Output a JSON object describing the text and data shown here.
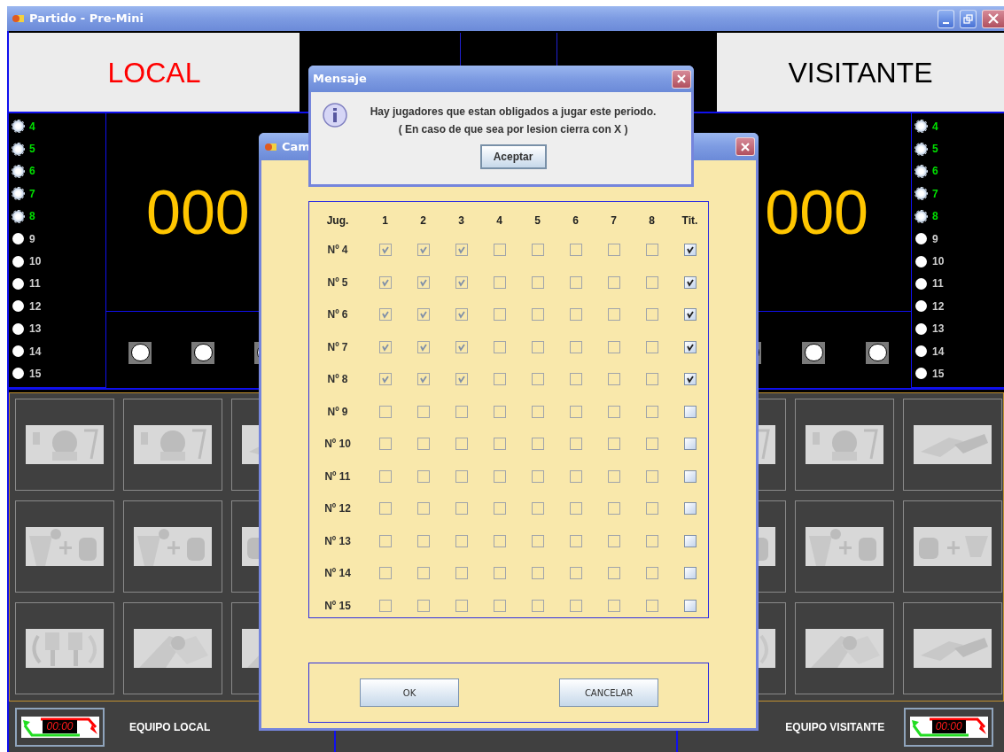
{
  "window": {
    "title": "Partido - Pre-Mini"
  },
  "home": {
    "name": "LOCAL",
    "score": "000",
    "players": [
      {
        "number": "4",
        "on_court": true
      },
      {
        "number": "5",
        "on_court": true
      },
      {
        "number": "6",
        "on_court": true
      },
      {
        "number": "7",
        "on_court": true
      },
      {
        "number": "8",
        "on_court": true
      },
      {
        "number": "9",
        "on_court": false
      },
      {
        "number": "10",
        "on_court": false
      },
      {
        "number": "11",
        "on_court": false
      },
      {
        "number": "12",
        "on_court": false
      },
      {
        "number": "13",
        "on_court": false
      },
      {
        "number": "14",
        "on_court": false
      },
      {
        "number": "15",
        "on_court": false
      }
    ],
    "team_label": "EQUIPO LOCAL",
    "clock": "00:00"
  },
  "away": {
    "name": "VISITANTE",
    "score": "000",
    "players": [
      {
        "number": "4",
        "on_court": true
      },
      {
        "number": "5",
        "on_court": true
      },
      {
        "number": "6",
        "on_court": true
      },
      {
        "number": "7",
        "on_court": true
      },
      {
        "number": "8",
        "on_court": true
      },
      {
        "number": "9",
        "on_court": false
      },
      {
        "number": "10",
        "on_court": false
      },
      {
        "number": "11",
        "on_court": false
      },
      {
        "number": "12",
        "on_court": false
      },
      {
        "number": "13",
        "on_court": false
      },
      {
        "number": "14",
        "on_court": false
      },
      {
        "number": "15",
        "on_court": false
      }
    ],
    "team_label": "EQUIPO VISITANTE",
    "clock": "00:00"
  },
  "change_dialog": {
    "title": "Cam",
    "columns": [
      "Jug.",
      "1",
      "2",
      "3",
      "4",
      "5",
      "6",
      "7",
      "8",
      "Tit."
    ],
    "period_boxes_disabled": true,
    "rows": [
      {
        "label": "Nº 4",
        "periods": [
          true,
          true,
          true,
          false,
          false,
          false,
          false,
          false
        ],
        "starter": true
      },
      {
        "label": "Nº 5",
        "periods": [
          true,
          true,
          true,
          false,
          false,
          false,
          false,
          false
        ],
        "starter": true
      },
      {
        "label": "Nº 6",
        "periods": [
          true,
          true,
          true,
          false,
          false,
          false,
          false,
          false
        ],
        "starter": true
      },
      {
        "label": "Nº 7",
        "periods": [
          true,
          true,
          true,
          false,
          false,
          false,
          false,
          false
        ],
        "starter": true
      },
      {
        "label": "Nº 8",
        "periods": [
          true,
          true,
          true,
          false,
          false,
          false,
          false,
          false
        ],
        "starter": true
      },
      {
        "label": "Nº 9",
        "periods": [
          false,
          false,
          false,
          false,
          false,
          false,
          false,
          false
        ],
        "starter": false
      },
      {
        "label": "Nº 10",
        "periods": [
          false,
          false,
          false,
          false,
          false,
          false,
          false,
          false
        ],
        "starter": false
      },
      {
        "label": "Nº 11",
        "periods": [
          false,
          false,
          false,
          false,
          false,
          false,
          false,
          false
        ],
        "starter": false
      },
      {
        "label": "Nº 12",
        "periods": [
          false,
          false,
          false,
          false,
          false,
          false,
          false,
          false
        ],
        "starter": false
      },
      {
        "label": "Nº 13",
        "periods": [
          false,
          false,
          false,
          false,
          false,
          false,
          false,
          false
        ],
        "starter": false
      },
      {
        "label": "Nº 14",
        "periods": [
          false,
          false,
          false,
          false,
          false,
          false,
          false,
          false
        ],
        "starter": false
      },
      {
        "label": "Nº 15",
        "periods": [
          false,
          false,
          false,
          false,
          false,
          false,
          false,
          false
        ],
        "starter": false
      }
    ],
    "buttons": [
      "OK",
      "CANCELAR"
    ]
  },
  "message_dialog": {
    "title": "Mensaje",
    "lines": [
      "Hay jugadores que estan obligados a jugar este periodo.",
      "( En caso de que sea por lesion cierra con X )"
    ],
    "button": "Aceptar"
  }
}
